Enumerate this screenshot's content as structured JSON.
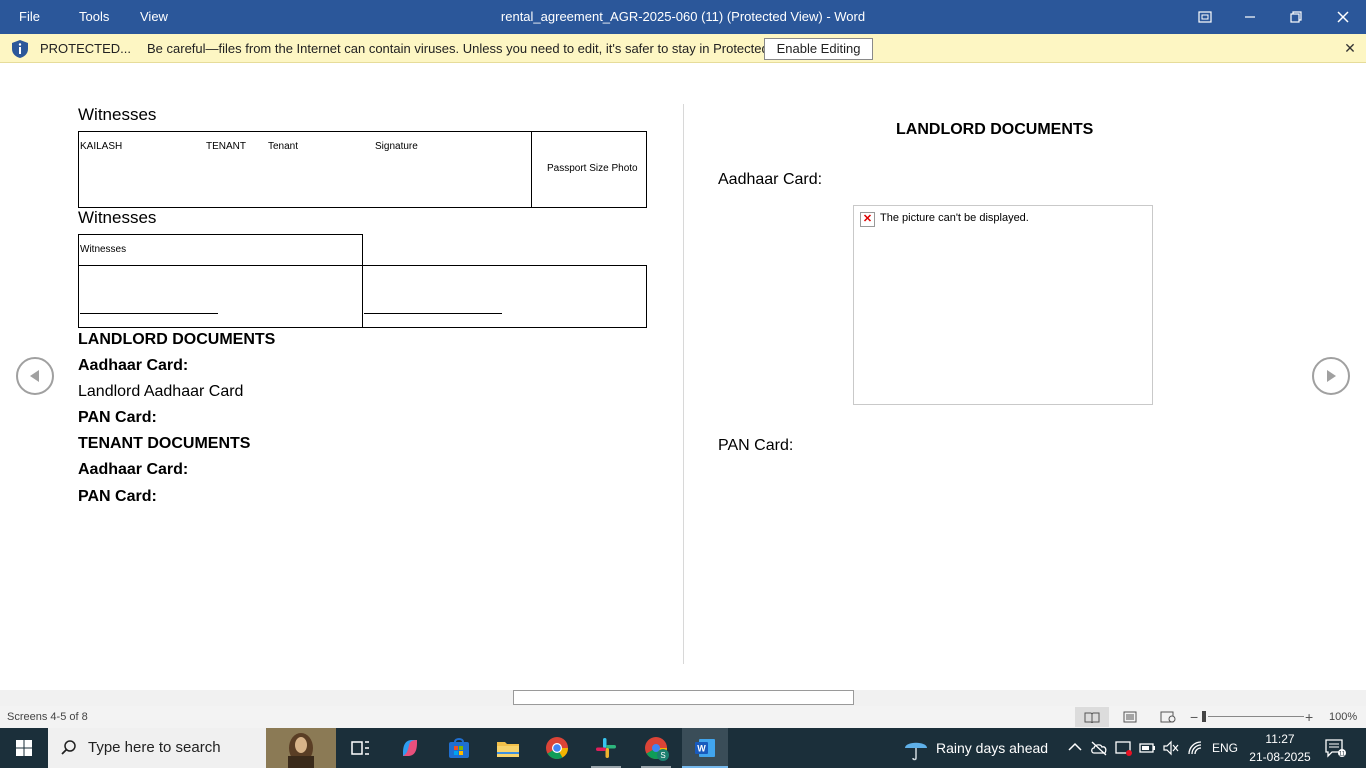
{
  "titlebar": {
    "menus": [
      "File",
      "Tools",
      "View"
    ],
    "title": "rental_agreement_AGR-2025-060 (11) (Protected View) - Word"
  },
  "message_bar": {
    "label": "PROTECTED...",
    "text": "Be careful—files from the Internet can contain viruses. Unless you need to edit, it's safer to stay in Protected View.",
    "button": "Enable Editing"
  },
  "left_page": {
    "witnesses_1": "Witnesses",
    "table1": {
      "name": "KAILASH",
      "role_upper": "TENANT",
      "role": "Tenant",
      "signature": "Signature",
      "photo": "Passport Size Photo"
    },
    "witnesses_2": "Witnesses",
    "table2_header": "Witnesses",
    "landlord_docs": "LANDLORD DOCUMENTS",
    "aadhaar_1": "Aadhaar Card:",
    "landlord_aadhaar": "Landlord Aadhaar Card",
    "pan_1": "PAN Card:",
    "tenant_docs": "TENANT DOCUMENTS",
    "aadhaar_2": "Aadhaar Card:",
    "pan_2": "PAN Card:"
  },
  "right_page": {
    "heading": "LANDLORD DOCUMENTS",
    "aadhaar": "Aadhaar Card:",
    "picture_error": "The picture can't be displayed.",
    "pan": "PAN Card:"
  },
  "statusbar": {
    "screens": "Screens 4-5 of 8",
    "zoom": "100%"
  },
  "taskbar": {
    "search_placeholder": "Type here to search",
    "weather": "Rainy days ahead",
    "language": "ENG",
    "time": "11:27",
    "date": "21-08-2025"
  },
  "colors": {
    "title_bar": "#2b579a",
    "message_bar": "#fdf6c3",
    "taskbar": "#1b2f3a"
  }
}
